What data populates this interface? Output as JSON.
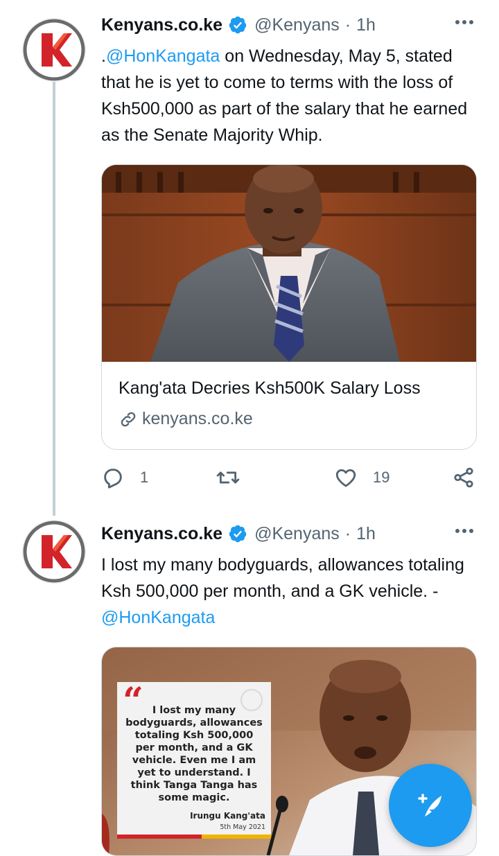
{
  "tweets": [
    {
      "display_name": "Kenyans.co.ke",
      "handle": "@Kenyans",
      "separator": "·",
      "time": "1h",
      "text_prefix": ".",
      "mention": "@HonKangata",
      "text_body": " on Wednesday, May 5, stated that he is yet to come to terms with the loss of Ksh500,000 as part of the salary that he earned as the Senate Majority Whip.",
      "card": {
        "title": "Kang'ata Decries Ksh500K Salary Loss",
        "domain": "kenyans.co.ke"
      },
      "actions": {
        "reply_count": "1",
        "retweet_count": "",
        "like_count": "19"
      }
    },
    {
      "display_name": "Kenyans.co.ke",
      "handle": "@Kenyans",
      "separator": "·",
      "time": "1h",
      "text_body": "I lost my many bodyguards, allowances totaling Ksh 500,000 per month, and a GK vehicle. - ",
      "mention": "@HonKangata",
      "media": {
        "quote_mark": "“",
        "quote_text": "I lost my many bodyguards, allowances totaling Ksh 500,000 per month, and a GK vehicle. Even me I am yet to understand. I think Tanga Tanga has some magic.",
        "quote_author": "Irungu Kang'ata",
        "quote_date": "5th May 2021"
      }
    }
  ],
  "icons": {
    "verified": "verified-badge-icon",
    "more": "more-options-icon",
    "reply": "reply-icon",
    "retweet": "retweet-icon",
    "like": "like-icon",
    "share": "share-icon",
    "link": "link-icon",
    "compose": "compose-tweet-icon"
  },
  "colors": {
    "accent": "#1d9bf0",
    "brand_red": "#d2232a",
    "secondary_text": "#536471"
  }
}
